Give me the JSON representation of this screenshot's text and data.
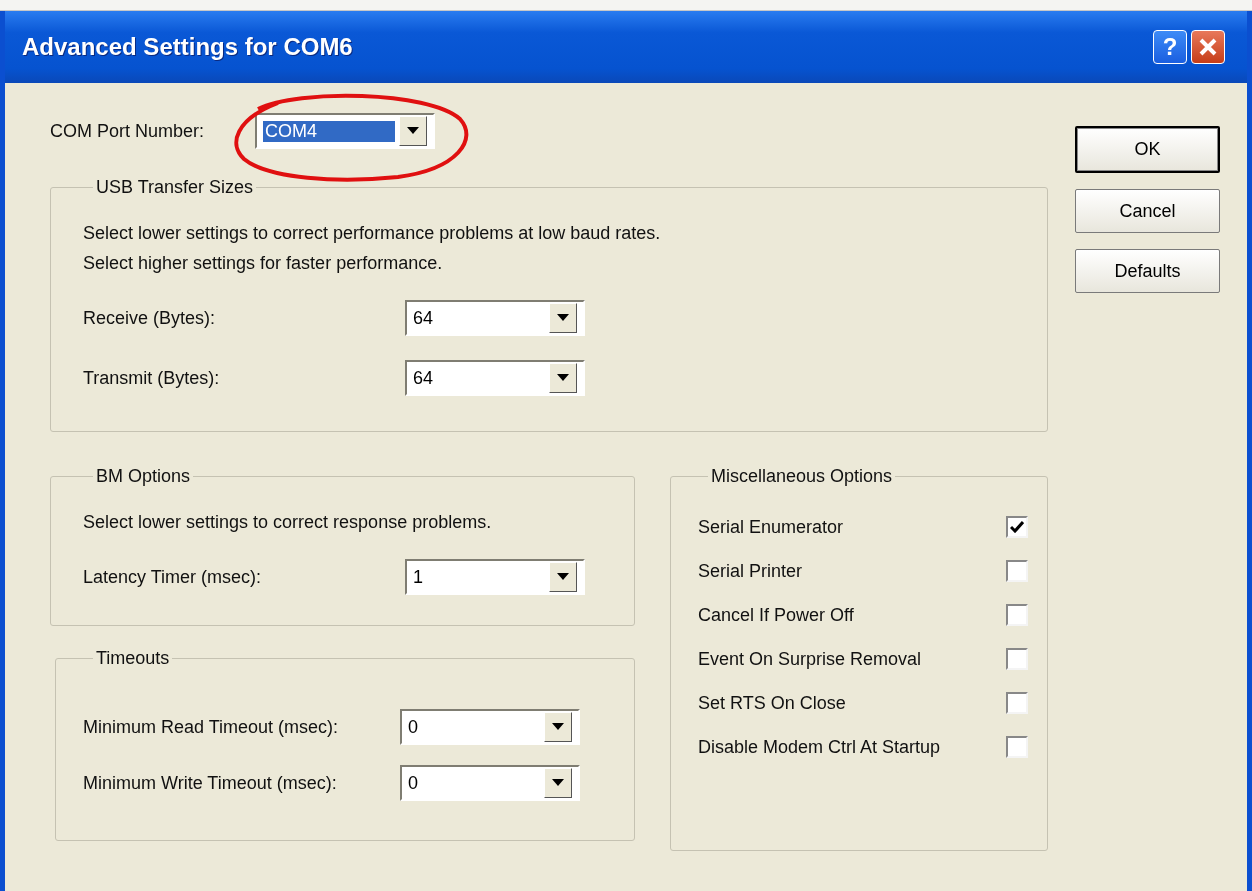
{
  "window": {
    "title": "Advanced Settings for COM6",
    "help_button": "?"
  },
  "com_port": {
    "label": "COM Port Number:",
    "value": "COM4",
    "focused": true
  },
  "usb_transfer": {
    "title": "USB Transfer Sizes",
    "description": [
      "Select lower settings to correct performance problems at low baud rates.",
      "Select higher settings for faster performance."
    ],
    "fields": [
      {
        "label": "Receive (Bytes):",
        "value": "64"
      },
      {
        "label": "Transmit (Bytes):",
        "value": "64"
      }
    ]
  },
  "bm_options": {
    "title": "BM Options",
    "description": "Select lower settings to correct response problems.",
    "fields": [
      {
        "label": "Latency Timer (msec):",
        "value": "1"
      }
    ]
  },
  "timeouts": {
    "title": "Timeouts",
    "fields": [
      {
        "label": "Minimum Read Timeout (msec):",
        "value": "0"
      },
      {
        "label": "Minimum Write Timeout (msec):",
        "value": "0"
      }
    ]
  },
  "misc_options": {
    "title": "Miscellaneous Options",
    "options": [
      {
        "label": "Serial Enumerator",
        "checked": true
      },
      {
        "label": "Serial Printer",
        "checked": false
      },
      {
        "label": "Cancel If Power Off",
        "checked": false
      },
      {
        "label": "Event On Surprise Removal",
        "checked": false
      },
      {
        "label": "Set RTS On Close",
        "checked": false
      },
      {
        "label": "Disable Modem Ctrl At Startup",
        "checked": false
      }
    ]
  },
  "buttons": [
    {
      "label": "OK",
      "default": true
    },
    {
      "label": "Cancel",
      "default": false
    },
    {
      "label": "Defaults",
      "default": false
    }
  ]
}
